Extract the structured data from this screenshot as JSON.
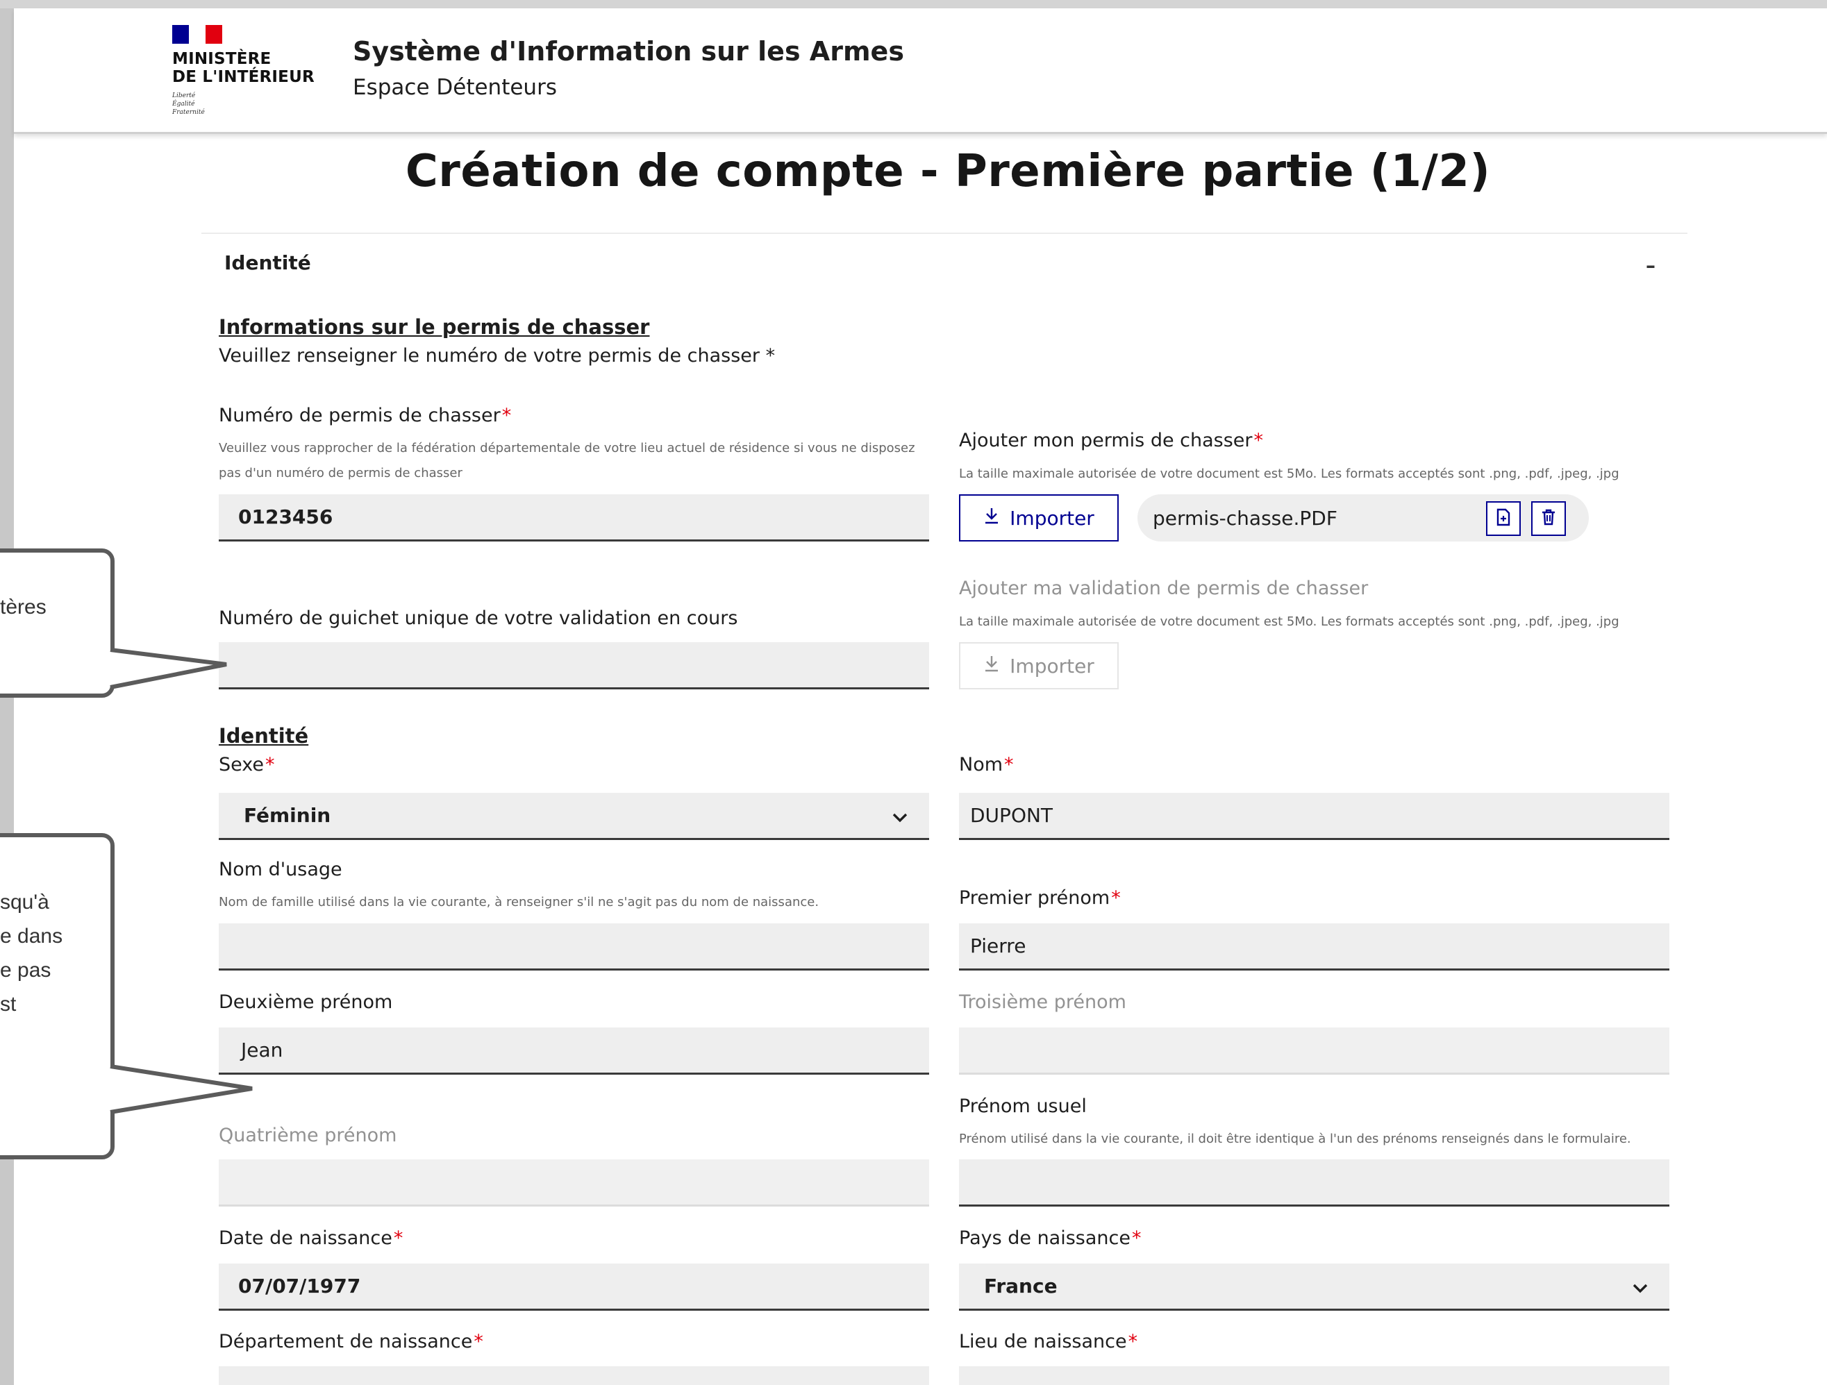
{
  "header": {
    "logo_text": "MINISTÈRE\nDE L'INTÉRIEUR",
    "logo_motto": "Liberté\nÉgalité\nFraternité",
    "app_title": "Système d'Information sur les Armes",
    "app_subtitle": "Espace Détenteurs"
  },
  "page": {
    "title": "Création de compte - Première partie (1/2)"
  },
  "section": {
    "title": "Identité",
    "collapse_symbol": "–"
  },
  "permis": {
    "heading": "Informations sur le permis de chasser",
    "instruction": "Veuillez renseigner le numéro de votre permis de chasser *",
    "numero_label": "Numéro de permis de chasser",
    "numero_hint_line1": "Veuillez vous rapprocher de la fédération départementale de votre lieu actuel de résidence si vous ne disposez",
    "numero_hint_line2": "pas d'un numéro de permis de chasser",
    "numero_value": "0123456",
    "upload_label": "Ajouter mon permis de chasser",
    "upload_hint": "La taille maximale autorisée de votre document est 5Mo. Les formats acceptés sont .png, .pdf, .jpeg, .jpg",
    "import_label": "Importer",
    "file_name": "permis-chasse.PDF",
    "guichet_label": "Numéro de guichet unique de votre validation en cours",
    "guichet_value": "",
    "validation_label": "Ajouter ma validation de permis de chasser",
    "validation_hint": "La taille maximale autorisée de votre document est 5Mo. Les formats acceptés sont .png, .pdf, .jpeg, .jpg",
    "validation_import_label": "Importer"
  },
  "identite": {
    "heading": "Identité",
    "sexe_label": "Sexe",
    "sexe_value": "Féminin",
    "nom_label": "Nom",
    "nom_value": "DUPONT",
    "nom_usage_label": "Nom d'usage",
    "nom_usage_hint": "Nom de famille utilisé dans la vie courante, à renseigner s'il ne s'agit pas du nom de naissance.",
    "nom_usage_value": "",
    "premier_prenom_label": "Premier prénom",
    "premier_prenom_value": "Pierre",
    "deuxieme_prenom_label": "Deuxième prénom",
    "deuxieme_prenom_value": "Jean",
    "troisieme_prenom_label": "Troisième prénom",
    "troisieme_prenom_value": "",
    "prenom_usuel_label": "Prénom usuel",
    "prenom_usuel_hint": "Prénom utilisé dans la vie courante, il doit être identique à l'un des prénoms renseignés dans le formulaire.",
    "prenom_usuel_value": "",
    "quatrieme_prenom_label": "Quatrième prénom",
    "quatrieme_prenom_value": "",
    "date_naissance_label": "Date de naissance",
    "date_naissance_value": "07/07/1977",
    "pays_naissance_label": "Pays de naissance",
    "pays_naissance_value": "France",
    "departement_naissance_label": "Département de naissance",
    "lieu_naissance_label": "Lieu de naissance",
    "required_mark": "*"
  },
  "callouts": {
    "first_line1": "tères",
    "second_line1": "squ'à",
    "second_line2": "e dans",
    "second_line3": "e pas",
    "second_line4": "st"
  },
  "colors": {
    "primary": "#000091",
    "required": "#e1000f",
    "field_bg": "#eeeeee"
  }
}
